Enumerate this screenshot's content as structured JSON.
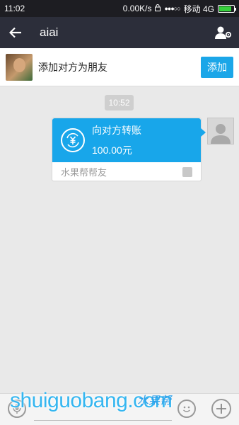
{
  "status_bar": {
    "time": "11:02",
    "speed": "0.00K/s",
    "carrier": "移动 4G",
    "battery_level": 0.85
  },
  "header": {
    "title": "aiai"
  },
  "add_friend_bar": {
    "label": "添加对方为朋友",
    "button": "添加"
  },
  "chat": {
    "timestamp": "10:52",
    "transfer": {
      "title": "向对方转账",
      "amount": "100.00元",
      "source": "水果帮帮友"
    }
  },
  "watermark": {
    "text": "shuiguobang.com",
    "cn": "水果帮"
  },
  "colors": {
    "accent": "#18a6ea",
    "header_bg": "#2c2e3a",
    "status_bg": "#1d1d22",
    "chat_bg": "#e9e9e9"
  }
}
